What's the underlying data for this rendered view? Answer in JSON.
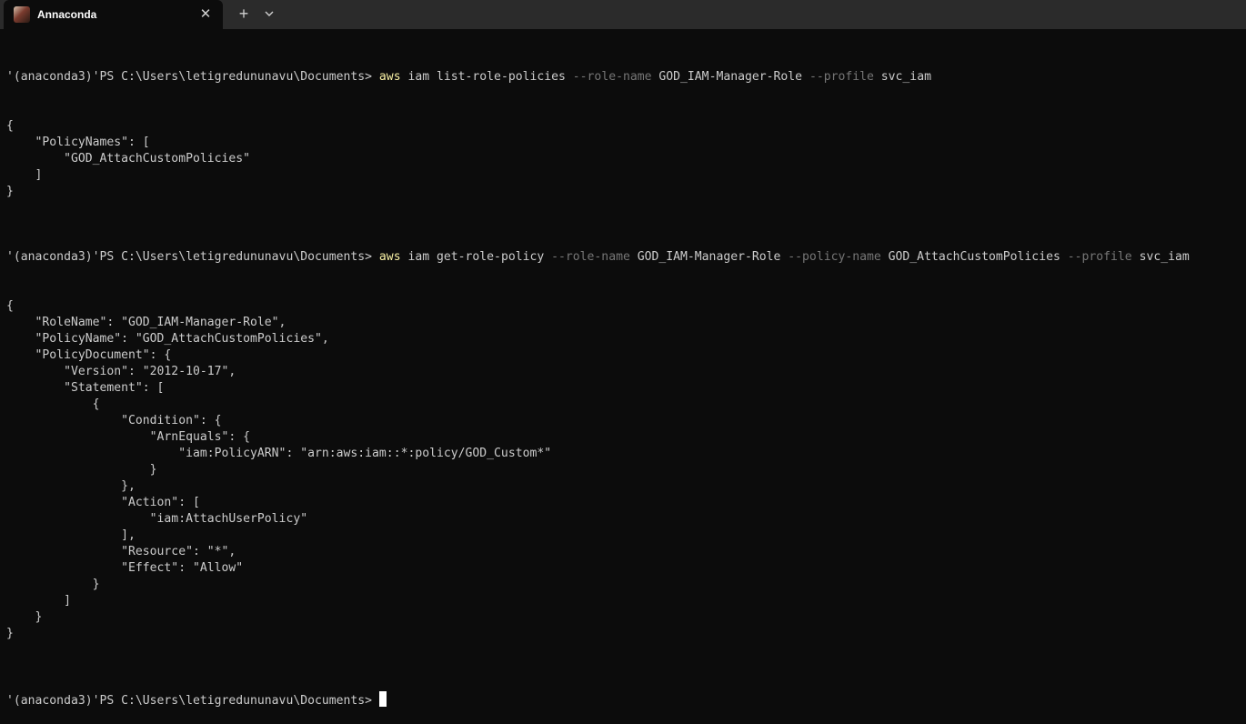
{
  "window": {
    "tab_title": "Annaconda",
    "tab_close_glyph": "✕",
    "new_tab_glyph": "+",
    "icons": [
      "app-avatar-icon",
      "close-icon",
      "plus-icon",
      "chevron-down-icon"
    ]
  },
  "colors": {
    "background": "#0c0c0c",
    "foreground": "#cccccc",
    "command": "#f9f1a5",
    "parameter": "#767676",
    "titlebar": "#2b2b2b"
  },
  "terminal": {
    "cmd1": {
      "prompt": "'(anaconda3)'PS C:\\Users\\letigredununavu\\Documents> ",
      "exe": "aws",
      "p1": " iam list-role-policies ",
      "flag1": "--role-name",
      "p2": " GOD_IAM-Manager-Role ",
      "flag2": "--profile",
      "p3": " svc_iam"
    },
    "out1": [
      "{",
      "    \"PolicyNames\": [",
      "        \"GOD_AttachCustomPolicies\"",
      "    ]",
      "}",
      ""
    ],
    "cmd2": {
      "prompt": "'(anaconda3)'PS C:\\Users\\letigredununavu\\Documents> ",
      "exe": "aws",
      "p1": " iam get-role-policy ",
      "flag1": "--role-name",
      "p2": " GOD_IAM-Manager-Role ",
      "flag2": "--policy-name",
      "p3": " GOD_AttachCustomPolicies ",
      "flag3": "--profile",
      "p4": " svc_iam"
    },
    "out2": [
      "{",
      "    \"RoleName\": \"GOD_IAM-Manager-Role\",",
      "    \"PolicyName\": \"GOD_AttachCustomPolicies\",",
      "    \"PolicyDocument\": {",
      "        \"Version\": \"2012-10-17\",",
      "        \"Statement\": [",
      "            {",
      "                \"Condition\": {",
      "                    \"ArnEquals\": {",
      "                        \"iam:PolicyARN\": \"arn:aws:iam::*:policy/GOD_Custom*\"",
      "                    }",
      "                },",
      "                \"Action\": [",
      "                    \"iam:AttachUserPolicy\"",
      "                ],",
      "                \"Resource\": \"*\",",
      "                \"Effect\": \"Allow\"",
      "            }",
      "        ]",
      "    }",
      "}",
      ""
    ],
    "prompt3": "'(anaconda3)'PS C:\\Users\\letigredununavu\\Documents> "
  }
}
